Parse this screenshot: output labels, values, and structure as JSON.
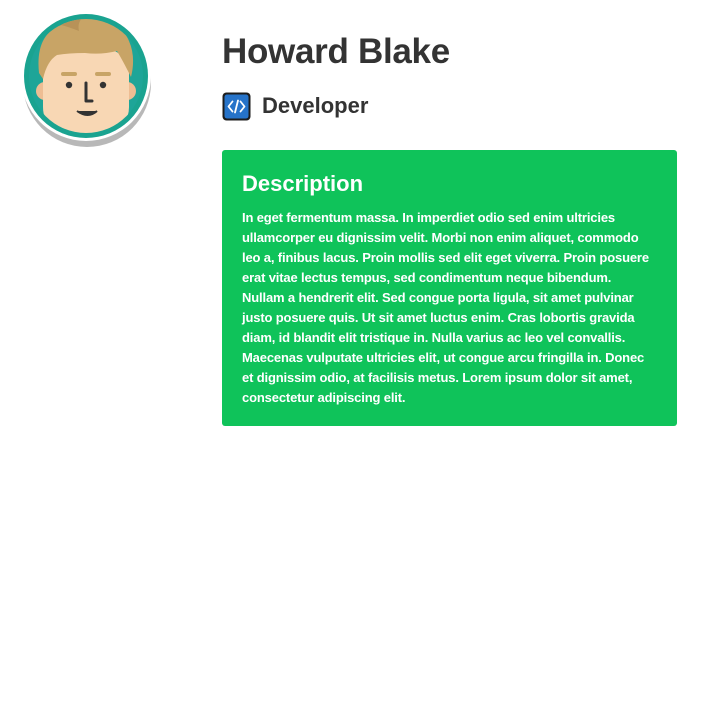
{
  "profile": {
    "name": "Howard Blake",
    "role": "Developer",
    "avatar_icon": "user-avatar-icon",
    "role_icon": "code-icon"
  },
  "description": {
    "title": "Description",
    "text": "In eget fermentum massa. In imperdiet odio sed enim ultricies ullamcorper eu dignissim velit. Morbi non enim aliquet, commodo leo a, finibus lacus. Proin mollis sed elit eget viverra. Proin posuere erat vitae lectus tempus, sed condimentum neque bibendum. Nullam a hendrerit elit. Sed congue porta ligula, sit amet pulvinar justo posuere quis. Ut sit amet luctus enim. Cras lobortis gravida diam, id blandit elit tristique in. Nulla varius ac leo vel convallis. Maecenas vulputate ultricies elit, ut congue arcu fringilla in. Donec et dignissim odio, at facilisis metus. Lorem ipsum dolor sit amet, consectetur adipiscing elit."
  },
  "colors": {
    "card_background": "#0fc35a",
    "avatar_ring": "#1aa390",
    "role_icon_background": "#2673c9",
    "text_dark": "#333333"
  }
}
